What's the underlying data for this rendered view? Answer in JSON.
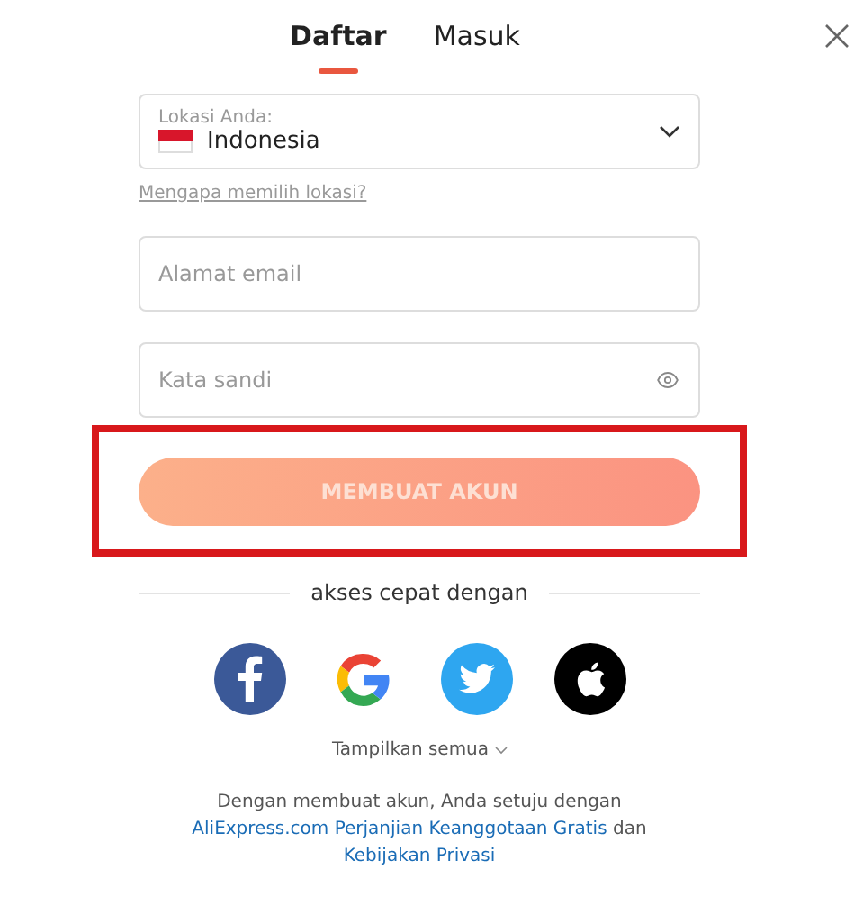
{
  "tabs": [
    {
      "label": "Daftar",
      "selected": true
    },
    {
      "label": "Masuk",
      "selected": false
    }
  ],
  "location": {
    "label": "Lokasi Anda:",
    "value": "Indonesia"
  },
  "location_help": "Mengapa memilih lokasi?",
  "email": {
    "placeholder": "Alamat email"
  },
  "password": {
    "placeholder": "Kata sandi"
  },
  "submit": {
    "label": "MEMBUAT AKUN",
    "disabled": true,
    "highlighted": true
  },
  "divider_text": "akses cepat dengan",
  "social": [
    {
      "kind": "facebook"
    },
    {
      "kind": "google"
    },
    {
      "kind": "twitter"
    },
    {
      "kind": "apple"
    }
  ],
  "show_all": "Tampilkan semua",
  "legal": {
    "text": "Dengan membuat akun, Anda setuju dengan",
    "link_1": "AliExpress.com Perjanjian Keanggotaan Gratis",
    "middle": "dan",
    "link_2": "Kebijakan Privasi"
  }
}
